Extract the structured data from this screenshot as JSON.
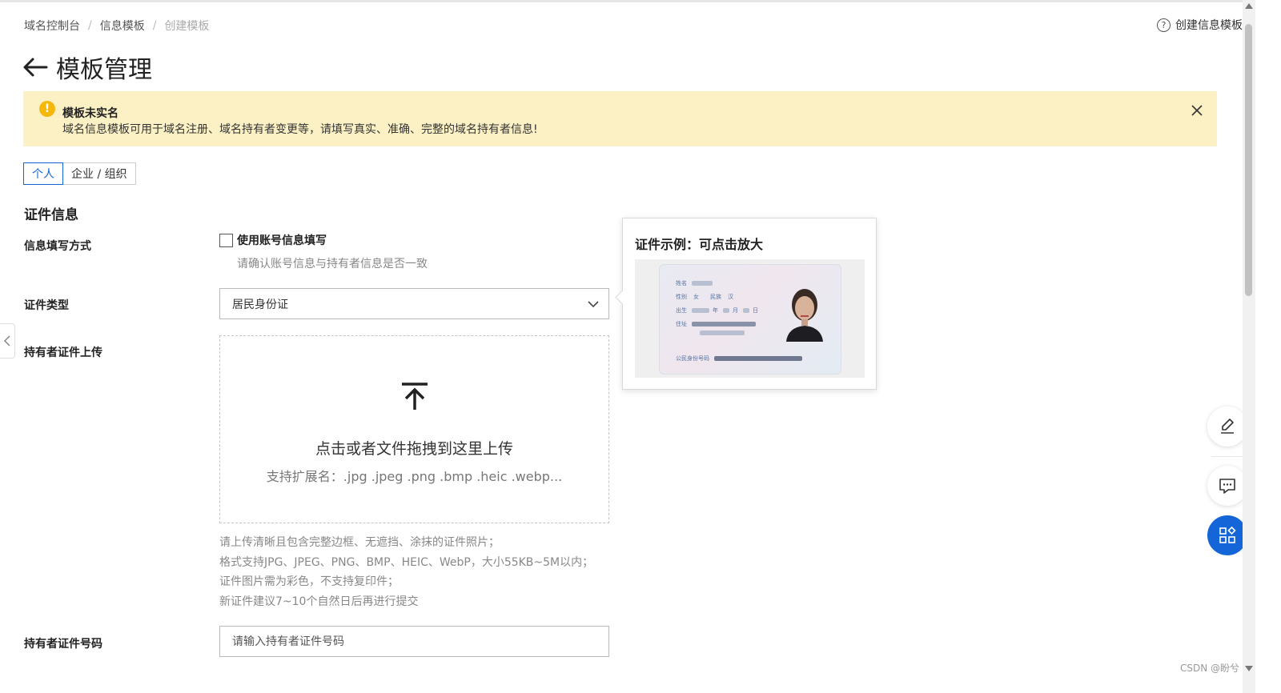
{
  "breadcrumb": {
    "items": [
      "域名控制台",
      "信息模板"
    ],
    "current": "创建模板",
    "separator": "/"
  },
  "header": {
    "help_icon": "?",
    "help_link": "创建信息模板",
    "title": "模板管理"
  },
  "alert": {
    "icon_text": "!",
    "title": "模板未实名",
    "message": "域名信息模板可用于域名注册、域名持有者变更等，请填写真实、准确、完整的域名持有者信息!"
  },
  "tabs": [
    {
      "label": "个人",
      "active": true
    },
    {
      "label": "企业 / 组织",
      "active": false
    }
  ],
  "form": {
    "section_title": "证件信息",
    "fill_method": {
      "label": "信息填写方式",
      "checkbox_label": "使用账号信息填写",
      "hint": "请确认账号信息与持有者信息是否一致"
    },
    "id_type": {
      "label": "证件类型",
      "value": "居民身份证"
    },
    "upload": {
      "label": "持有者证件上传",
      "title": "点击或者文件拖拽到这里上传",
      "subtitle": "支持扩展名：.jpg .jpeg .png .bmp .heic .webp...",
      "tips": [
        "请上传清晰且包含完整边框、无遮挡、涂抹的证件照片；",
        "格式支持JPG、JPEG、PNG、BMP、HEIC、WebP，大小55KB~5M以内；",
        "证件图片需为彩色，不支持复印件；",
        "新证件建议7~10个自然日后再进行提交"
      ]
    },
    "id_number": {
      "label": "持有者证件号码",
      "placeholder": "请输入持有者证件号码"
    }
  },
  "popover": {
    "title": "证件示例：可点击放大",
    "card": {
      "name_label": "姓名",
      "gender_label": "性别",
      "gender_value": "女",
      "ethnicity_label": "民族",
      "ethnicity_value": "汉",
      "birth_label": "出生",
      "year": "年",
      "month": "月",
      "day": "日",
      "address_label": "住址",
      "id_label": "公民身份号码"
    }
  },
  "watermark": "CSDN @盼兮",
  "colors": {
    "primary": "#1365d8",
    "alert_bg": "#fcf1c5",
    "warning": "#f5b80a"
  }
}
